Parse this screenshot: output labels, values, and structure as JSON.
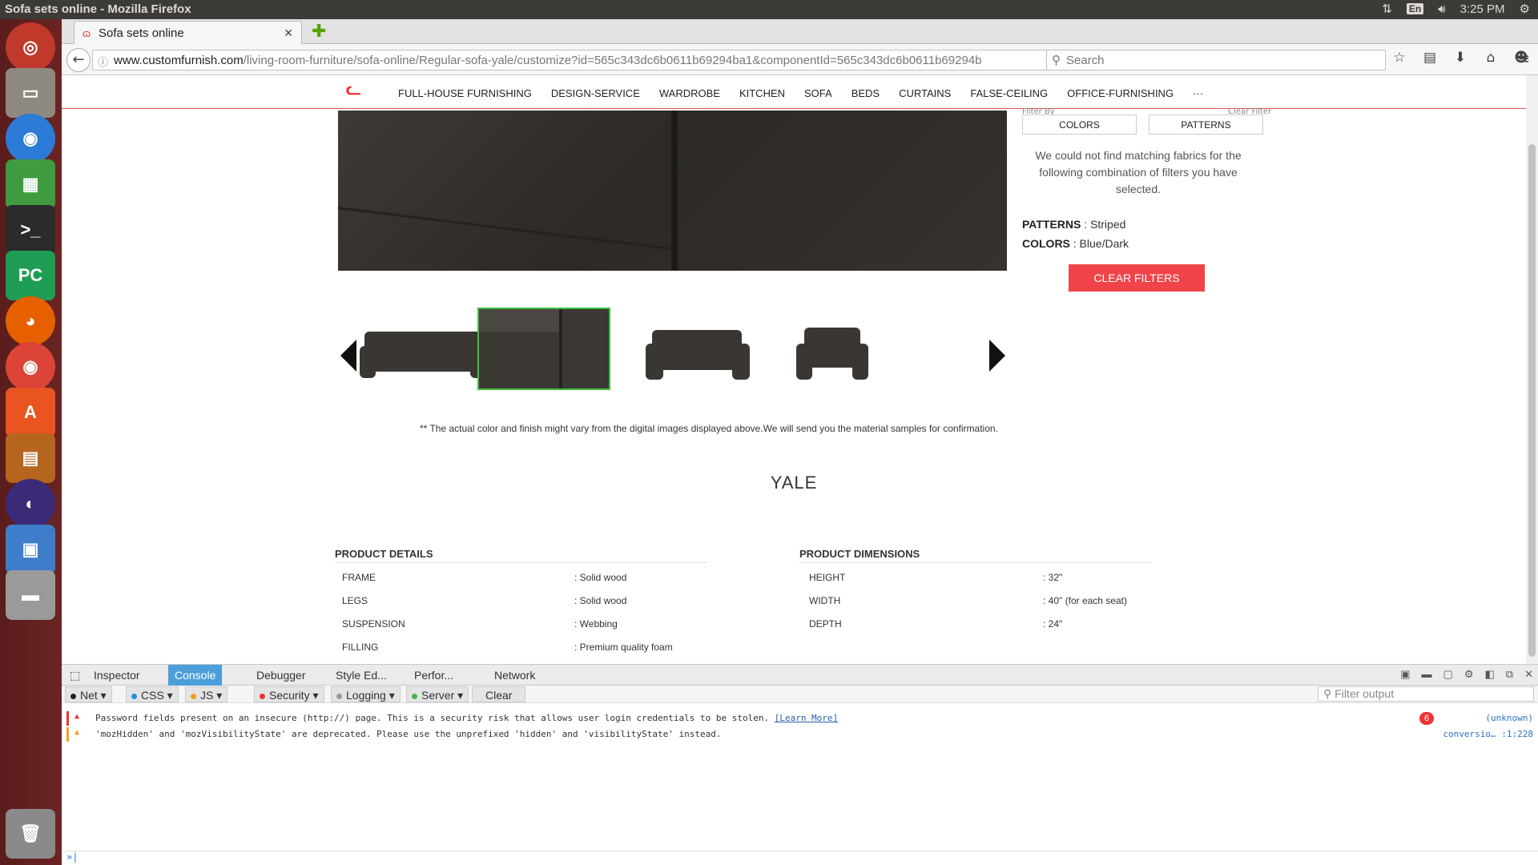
{
  "os": {
    "window_title": "Sofa sets online - Mozilla Firefox",
    "language": "En",
    "time": "3:25 PM",
    "launcher_icons": [
      "ubuntu-icon",
      "files-icon",
      "chromium-icon",
      "spreadsheet-icon",
      "terminal-icon",
      "pycharm-icon",
      "firefox-icon",
      "chrome-icon",
      "software-center-icon",
      "impress-icon",
      "eclipse-icon",
      "image-viewer-icon",
      "disk-icon",
      "trash-icon"
    ]
  },
  "browser": {
    "tab_title": "Sofa sets online",
    "url_host": "www.customfurnish.com",
    "url_path": "/living-room-furniture/sofa-online/Regular-sofa-yale/customize?id=565c343dc6b0611b69294ba1&componentId=565c343dc6b0611b69294b",
    "search_placeholder": "Search"
  },
  "site": {
    "menu": [
      "FULL-HOUSE FURNISHING",
      "DESIGN-SERVICE",
      "WARDROBE",
      "KITCHEN",
      "SOFA",
      "BEDS",
      "CURTAINS",
      "FALSE-CEILING",
      "OFFICE-FURNISHING",
      "···"
    ],
    "filter_by": "Filter By",
    "clear_filter": "Clear Filter",
    "filter_colors": "COLORS",
    "filter_patterns": "PATTERNS",
    "no_match_message": "We could not find matching fabrics for the following combination of filters you have selected.",
    "patterns_label": "PATTERNS",
    "patterns_value": ": Striped",
    "colors_label": "COLORS",
    "colors_value": ": Blue/Dark",
    "clear_filters_button": "CLEAR FILTERS",
    "disclaimer": "** The actual color and finish might vary from the digital images displayed above.We will send you the material samples for confirmation.",
    "product_name": "YALE",
    "details_title": "PRODUCT DETAILS",
    "details": [
      {
        "label": "FRAME",
        "value": ": Solid wood"
      },
      {
        "label": "LEGS",
        "value": ": Solid wood"
      },
      {
        "label": "SUSPENSION",
        "value": ": Webbing"
      },
      {
        "label": "FILLING",
        "value": ": Premium quality foam"
      }
    ],
    "dimensions_title": "PRODUCT DIMENSIONS",
    "dimensions": [
      {
        "label": "HEIGHT",
        "value": ": 32\""
      },
      {
        "label": "WIDTH",
        "value": ": 40\" (for each seat)"
      },
      {
        "label": "DEPTH",
        "value": ": 24\""
      }
    ]
  },
  "devtools": {
    "tabs": [
      "Inspector",
      "Console",
      "Debugger",
      "Style Ed...",
      "Perfor...",
      "Network"
    ],
    "active_tab": "Console",
    "filters": [
      "Net",
      "CSS",
      "JS",
      "Security",
      "Logging",
      "Server"
    ],
    "clear_label": "Clear",
    "filter_placeholder": "Filter output",
    "messages": [
      {
        "text": "Password fields present on an insecure (http://) page. This is a security risk that allows user login credentials to be stolen.",
        "link": "[Learn More]",
        "count": "6",
        "source": "(unknown)"
      },
      {
        "text": "'mozHidden' and 'mozVisibilityState' are deprecated.  Please use the unprefixed 'hidden' and 'visibilityState' instead.",
        "source": "conversio… :1:228"
      }
    ],
    "prompt": "»"
  },
  "colors": {
    "accent": "#f0444a",
    "devtools_active": "#4c9ed9",
    "selected_thumb": "#3cbf3c"
  }
}
